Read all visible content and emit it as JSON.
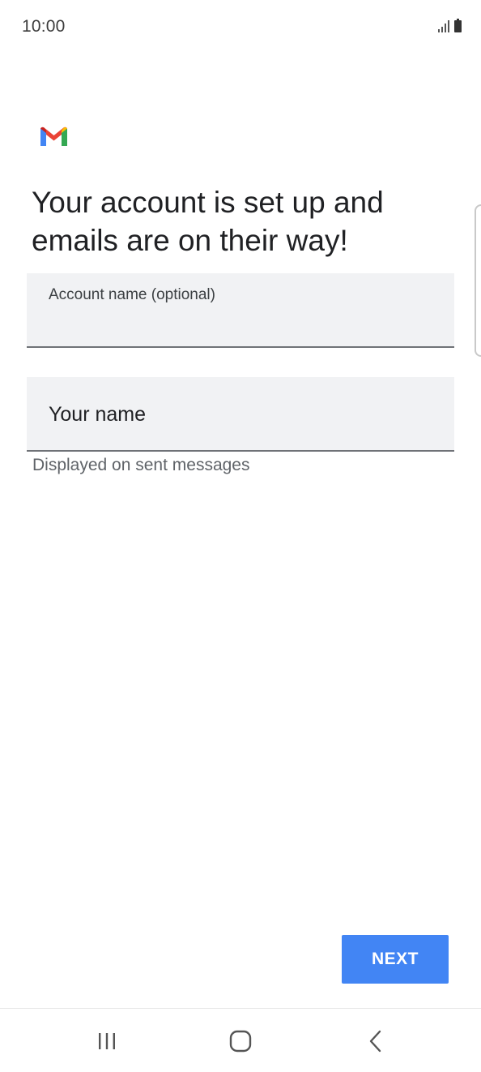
{
  "status_bar": {
    "time": "10:00",
    "icons": [
      "signal-icon",
      "battery-icon"
    ]
  },
  "app": {
    "logo": "gmail-logo-icon"
  },
  "headline": "Your account is set up and emails are on their way!",
  "account_name_field": {
    "label": "Account name (optional)",
    "value": ""
  },
  "your_name_field": {
    "placeholder": "Your name",
    "value": "",
    "helper": "Displayed on sent messages"
  },
  "next_button": {
    "label": "NEXT",
    "color": "#4285f4"
  },
  "nav_bar": {
    "icons": [
      "recents-icon",
      "home-icon",
      "back-icon"
    ]
  },
  "colors": {
    "gmail_red": "#ea4335",
    "gmail_blue": "#4285f4",
    "gmail_green": "#34a853",
    "gmail_yellow": "#fbbc04",
    "field_bg": "#f1f2f4"
  }
}
